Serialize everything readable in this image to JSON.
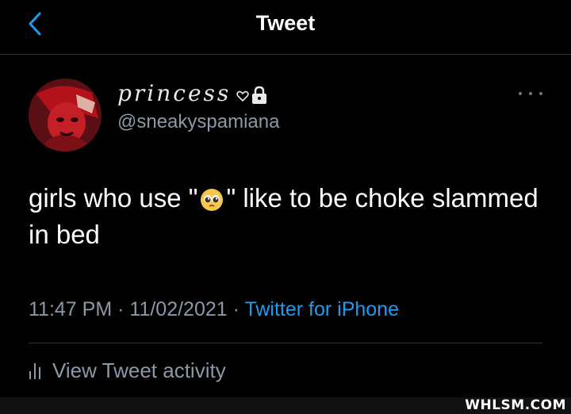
{
  "header": {
    "title": "Tweet",
    "back_icon": "chevron-left-icon"
  },
  "tweet": {
    "author": {
      "display_name": "princess",
      "handle": "@sneakyspamiana",
      "icons": [
        "heart-icon",
        "lock-icon"
      ]
    },
    "text_before_emoji": "girls who use \"",
    "emoji": "pleading-face-emoji",
    "text_after_emoji": "\" like to be choke slammed in bed",
    "timestamp": "11:47 PM",
    "date": "11/02/2021",
    "separator": "·",
    "source": "Twitter for iPhone",
    "activity_label": "View Tweet activity"
  },
  "colors": {
    "background": "#000000",
    "link": "#1d9bf0",
    "secondary_text": "#8b98a5"
  },
  "watermark": "WHLSM.COM"
}
